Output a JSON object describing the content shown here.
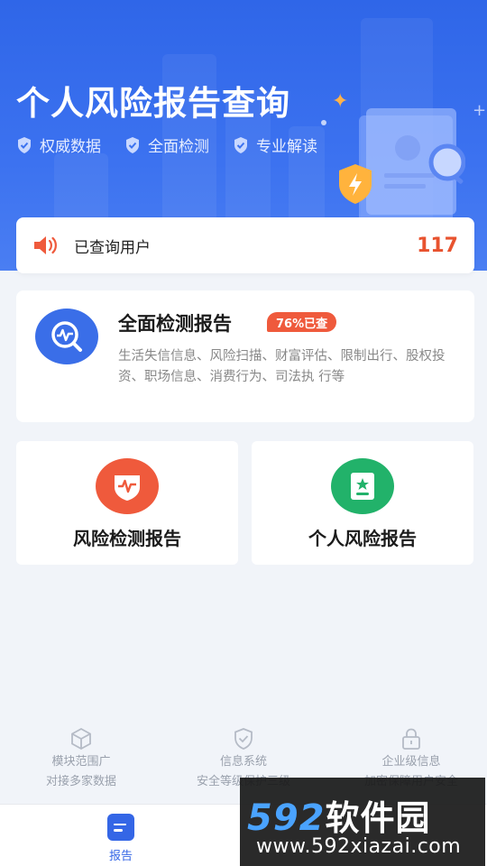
{
  "hero": {
    "title": "个人风险报告查询",
    "features": [
      "权威数据",
      "全面检测",
      "专业解读"
    ]
  },
  "user_count": {
    "label": "已查询用户",
    "value": "117"
  },
  "report_card": {
    "title": "全面检测报告",
    "badge": "76%已查",
    "description": "生活失信信息、风险扫描、财富评估、限制出行、股权投资、职场信息、消费行为、司法执 行等"
  },
  "tiles": [
    {
      "label": "风险检测报告",
      "color": "#ef5a3c",
      "icon": "shield-heartbeat-icon"
    },
    {
      "label": "个人风险报告",
      "color": "#22b26a",
      "icon": "document-star-icon"
    }
  ],
  "footer_info": [
    {
      "line1": "模块范围广",
      "line2": "对接多家数据",
      "icon": "cube-icon"
    },
    {
      "line1": "信息系统",
      "line2": "安全等级保护三级",
      "icon": "shield-check-icon"
    },
    {
      "line1": "企业级信息",
      "line2": "加密保障用户安全",
      "icon": "lock-icon"
    }
  ],
  "tabbar": {
    "tab_report": "报告"
  },
  "watermark": {
    "brand_num": "592",
    "brand_cn": "软件园",
    "url": "www.592xiazai.com"
  },
  "colors": {
    "primary": "#3466e6",
    "accent_red": "#ef5a3c",
    "accent_green": "#22b26a",
    "count_color": "#e8532f"
  }
}
